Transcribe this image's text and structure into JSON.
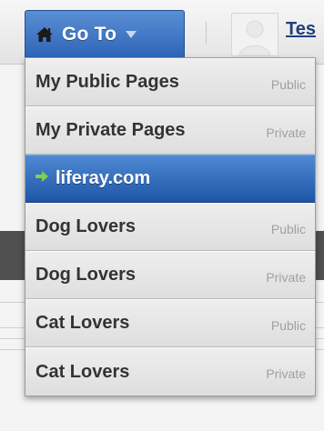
{
  "colors": {
    "accent": "#2e64b7",
    "accent_light": "#5a8fd4",
    "menu_bg": "#e4e4e4",
    "label_text": "#333333",
    "tag_text": "#a0a0a0",
    "arrow": "#7fd04a",
    "user_link": "#1f3f7a"
  },
  "header": {
    "goto_label": "Go To",
    "home_icon": "home-icon",
    "caret_icon": "caret-down-icon",
    "user_name_visible": "Tes",
    "avatar_icon": "default-avatar-icon"
  },
  "menu": {
    "items": [
      {
        "label": "My Public Pages",
        "tag": "Public",
        "active": false
      },
      {
        "label": "My Private Pages",
        "tag": "Private",
        "active": false
      },
      {
        "label": "liferay.com",
        "tag": "",
        "active": true,
        "icon": "green-arrow-icon"
      },
      {
        "label": "Dog Lovers",
        "tag": "Public",
        "active": false
      },
      {
        "label": "Dog Lovers",
        "tag": "Private",
        "active": false
      },
      {
        "label": "Cat Lovers",
        "tag": "Public",
        "active": false
      },
      {
        "label": "Cat Lovers",
        "tag": "Private",
        "active": false
      }
    ]
  }
}
